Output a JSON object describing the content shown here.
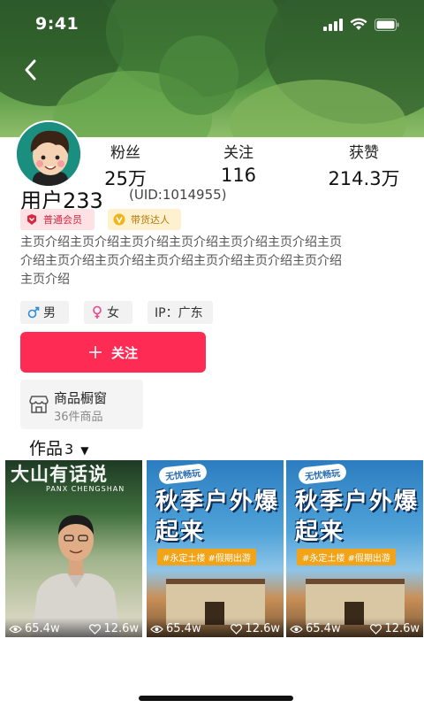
{
  "status_bar": {
    "time": "9:41"
  },
  "profile": {
    "username": "用户233",
    "uid": "(UID:1014955)",
    "badges": [
      {
        "label": "普通会员",
        "color": "#d8283f"
      },
      {
        "label": "带货达人",
        "color": "#b8780a"
      }
    ],
    "intro": "主页介绍主页介绍主页介绍主页介绍主页介绍主页介绍主页介绍主页介绍主页介绍主页介绍主页介绍主页介绍主页介绍主页介绍",
    "tags": [
      {
        "icon": "male-icon",
        "label": "男"
      },
      {
        "icon": "female-icon",
        "label": "女"
      },
      {
        "label": "IP：广东"
      }
    ]
  },
  "stats": [
    {
      "label": "粉丝",
      "value": "25万"
    },
    {
      "label": "关注",
      "value": "116"
    },
    {
      "label": "获赞",
      "value": "214.3万"
    }
  ],
  "follow_button": {
    "label": "关注",
    "color": "#fe2c55"
  },
  "shop": {
    "title": "商品橱窗",
    "subtitle": "36件商品"
  },
  "works_tab": {
    "label": "作品",
    "count": "3"
  },
  "videos": [
    {
      "views": "65.4w",
      "likes": "12.6w",
      "poster_text": "大山有话说",
      "poster_subtext": "PANX CHENGSHAN"
    },
    {
      "views": "65.4w",
      "likes": "12.6w",
      "poster_badge": "无忧畅玩",
      "poster_title": "秋季户外爆起来",
      "poster_tags": "#永定土楼 #假期出游"
    },
    {
      "views": "65.4w",
      "likes": "12.6w",
      "poster_badge": "无忧畅玩",
      "poster_title": "秋季户外爆起来",
      "poster_tags": "#永定土楼 #假期出游"
    }
  ]
}
